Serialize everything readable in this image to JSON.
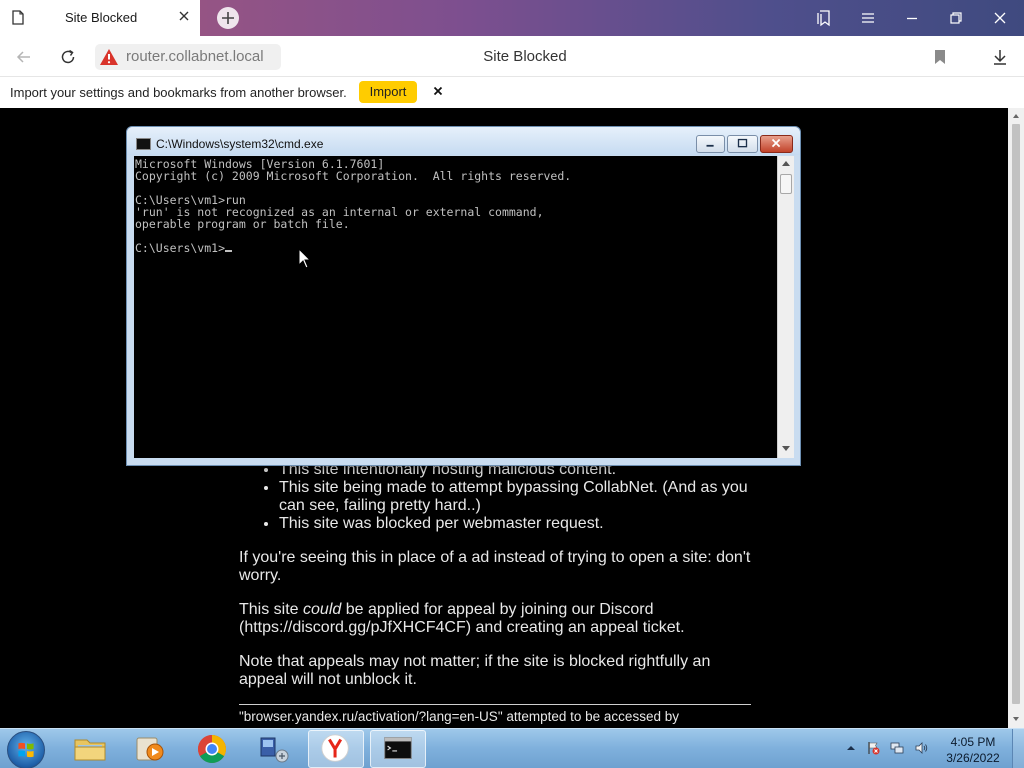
{
  "browser": {
    "tab": {
      "title": "Site Blocked"
    },
    "address": {
      "url": "router.collabnet.local",
      "page_title": "Site Blocked"
    },
    "infobar": {
      "text": "Import your settings and bookmarks from another browser.",
      "import_label": "Import"
    }
  },
  "page": {
    "bullets": [
      "This site intentionally hosting malicious content.",
      "This site being made to attempt bypassing CollabNet. (And as you can see, failing pretty hard..)",
      "This site was blocked per webmaster request."
    ],
    "para_ad": "If you're seeing this in place of a ad instead of trying to open a site: don't worry.",
    "para_appeal_pre": "This site ",
    "para_appeal_em": "could",
    "para_appeal_post": " be applied for appeal by joining our Discord (https://discord.gg/pJfXHCF4CF) and creating an appeal ticket.",
    "para_note": "Note that appeals may not matter; if the site is blocked rightfully an appeal will not unblock it.",
    "footer": "\"browser.yandex.ru/activation/?lang=en-US\" attempted to be accessed by"
  },
  "cmd": {
    "title": "C:\\Windows\\system32\\cmd.exe",
    "lines": [
      "Microsoft Windows [Version 6.1.7601]",
      "Copyright (c) 2009 Microsoft Corporation.  All rights reserved.",
      "",
      "C:\\Users\\vm1>run",
      "'run' is not recognized as an internal or external command,",
      "operable program or batch file.",
      "",
      "C:\\Users\\vm1>"
    ]
  },
  "taskbar": {
    "clock": {
      "time": "4:05 PM",
      "date": "3/26/2022"
    },
    "items": [
      "explorer",
      "media-player",
      "chrome",
      "network-app",
      "yandex-browser",
      "command-prompt"
    ]
  },
  "colors": {
    "import_button": "#ffcc00",
    "warning": "#d9342b",
    "page_background": "#000000"
  }
}
